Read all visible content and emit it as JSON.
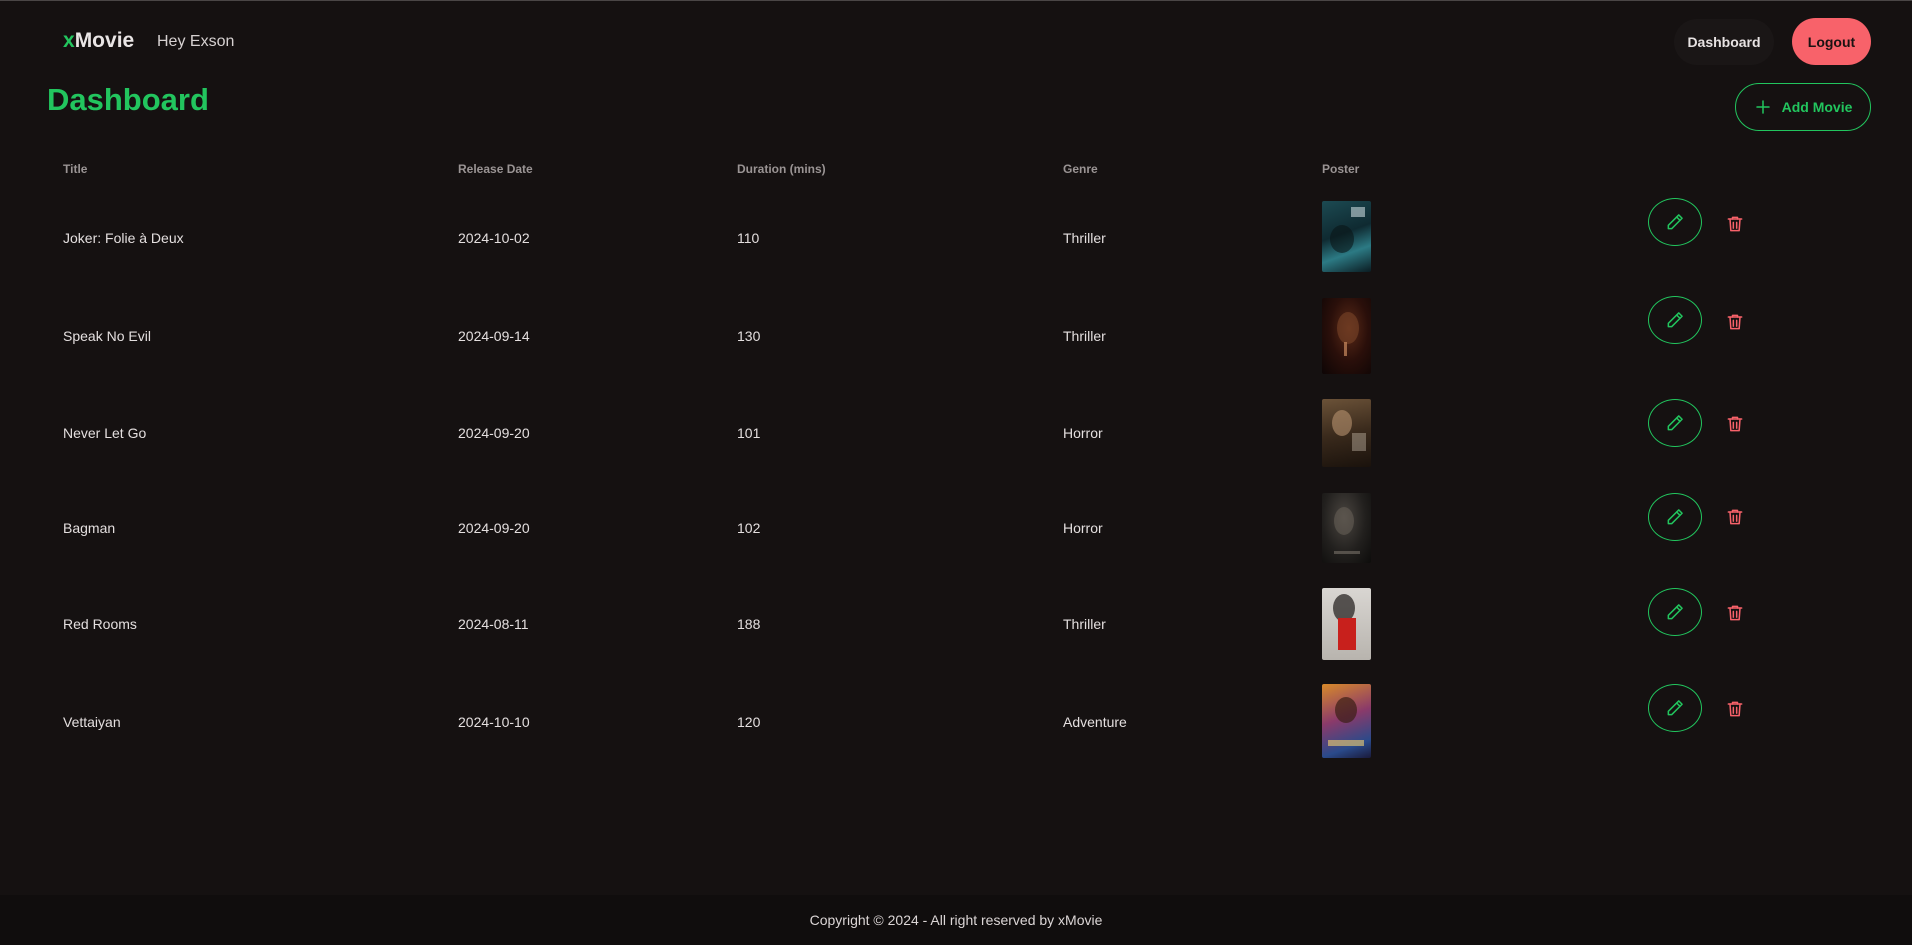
{
  "nav": {
    "brand_x": "x",
    "brand_rest": "Movie",
    "greeting": "Hey Exson",
    "dashboard_label": "Dashboard",
    "logout_label": "Logout"
  },
  "page": {
    "title": "Dashboard",
    "add_movie_label": "Add Movie"
  },
  "table": {
    "headers": [
      "Title",
      "Release Date",
      "Duration (mins)",
      "Genre",
      "Poster"
    ],
    "rows": [
      {
        "title": "Joker: Folie à Deux",
        "release_date": "2024-10-02",
        "duration": "110",
        "genre": "Thriller",
        "poster": "joker-poster"
      },
      {
        "title": "Speak No Evil",
        "release_date": "2024-09-14",
        "duration": "130",
        "genre": "Thriller",
        "poster": "speak-no-evil-poster"
      },
      {
        "title": "Never Let Go",
        "release_date": "2024-09-20",
        "duration": "101",
        "genre": "Horror",
        "poster": "never-let-go-poster"
      },
      {
        "title": "Bagman",
        "release_date": "2024-09-20",
        "duration": "102",
        "genre": "Horror",
        "poster": "bagman-poster"
      },
      {
        "title": "Red Rooms",
        "release_date": "2024-08-11",
        "duration": "188",
        "genre": "Thriller",
        "poster": "red-rooms-poster"
      },
      {
        "title": "Vettaiyan",
        "release_date": "2024-10-10",
        "duration": "120",
        "genre": "Adventure",
        "poster": "vettaiyan-poster"
      }
    ]
  },
  "icons": {
    "add": "plus-icon",
    "edit": "pencil-icon",
    "delete": "trash-icon"
  },
  "colors": {
    "accent": "#22c55e",
    "danger": "#f8626a",
    "background": "#151111"
  },
  "footer": {
    "text": "Copyright © 2024 - All right reserved by xMovie"
  }
}
